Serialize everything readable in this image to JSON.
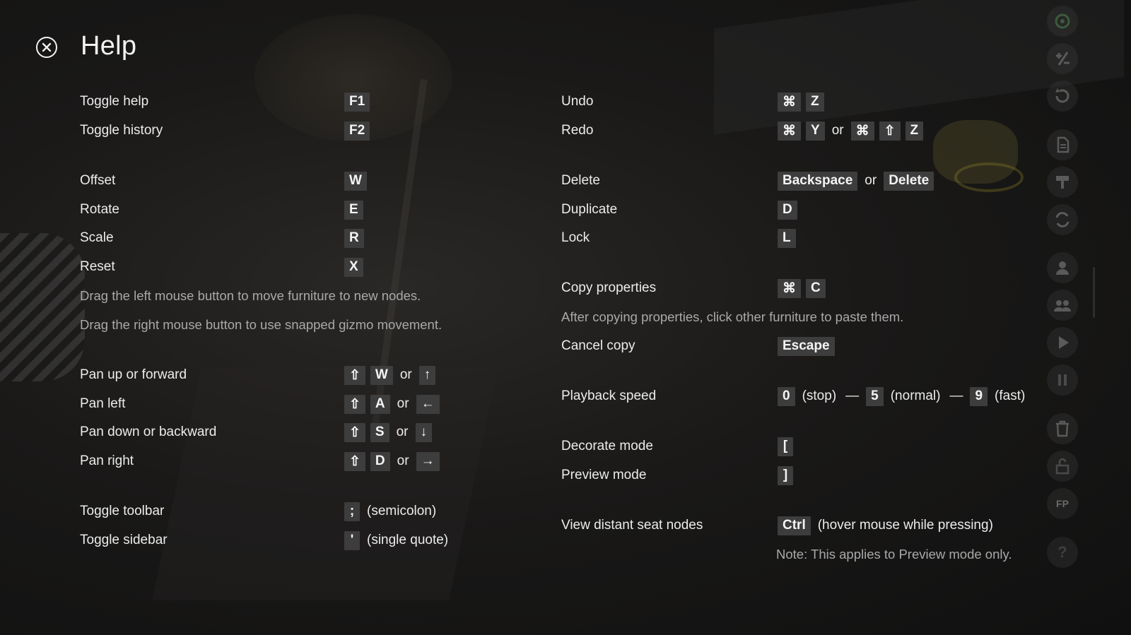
{
  "title": "Help",
  "left": {
    "toggle_help": {
      "label": "Toggle help",
      "key": "F1"
    },
    "toggle_history": {
      "label": "Toggle history",
      "key": "F2"
    },
    "offset": {
      "label": "Offset",
      "key": "W"
    },
    "rotate": {
      "label": "Rotate",
      "key": "E"
    },
    "scale": {
      "label": "Scale",
      "key": "R"
    },
    "reset": {
      "label": "Reset",
      "key": "X"
    },
    "note_drag_left": "Drag the left mouse button to move furniture to new nodes.",
    "note_drag_right": "Drag the right mouse button to use snapped gizmo movement.",
    "pan_up": {
      "label": "Pan up or forward",
      "mod": "⇧",
      "key": "W",
      "or": "or",
      "alt": "↑"
    },
    "pan_left": {
      "label": "Pan left",
      "mod": "⇧",
      "key": "A",
      "or": "or",
      "alt": "←"
    },
    "pan_down": {
      "label": "Pan down or backward",
      "mod": "⇧",
      "key": "S",
      "or": "or",
      "alt": "↓"
    },
    "pan_right": {
      "label": "Pan right",
      "mod": "⇧",
      "key": "D",
      "or": "or",
      "alt": "→"
    },
    "toggle_toolbar": {
      "label": "Toggle toolbar",
      "key": ";",
      "desc": "(semicolon)"
    },
    "toggle_sidebar": {
      "label": "Toggle sidebar",
      "key": "'",
      "desc": "(single quote)"
    }
  },
  "right": {
    "undo": {
      "label": "Undo",
      "k1": "⌘",
      "k2": "Z"
    },
    "redo": {
      "label": "Redo",
      "k1": "⌘",
      "k2": "Y",
      "or": "or",
      "k3": "⌘",
      "k4": "⇧",
      "k5": "Z"
    },
    "delete": {
      "label": "Delete",
      "k1": "Backspace",
      "or": "or",
      "k2": "Delete"
    },
    "duplicate": {
      "label": "Duplicate",
      "key": "D"
    },
    "lock": {
      "label": "Lock",
      "key": "L"
    },
    "copy_properties": {
      "label": "Copy properties",
      "k1": "⌘",
      "k2": "C"
    },
    "note_copy": "After copying properties, click other furniture to paste them.",
    "cancel_copy": {
      "label": "Cancel copy",
      "key": "Escape"
    },
    "playback_speed": {
      "label": "Playback speed",
      "k0": "0",
      "t0": "(stop)",
      "dash1": "—",
      "k5": "5",
      "t5": "(normal)",
      "dash2": "—",
      "k9": "9",
      "t9": "(fast)"
    },
    "decorate_mode": {
      "label": "Decorate mode",
      "key": "["
    },
    "preview_mode": {
      "label": "Preview mode",
      "key": "]"
    },
    "view_seat_nodes": {
      "label": "View distant seat nodes",
      "key": "Ctrl",
      "desc": "(hover mouse while pressing)"
    },
    "note_preview": "Note: This applies to Preview mode only."
  },
  "toolbar": {
    "icons": [
      "target-icon",
      "plus-minus-icon",
      "rotate-icon",
      "document-icon",
      "paint-roller-icon",
      "swap-icon",
      "person-icon",
      "group-icon",
      "play-icon",
      "pause-icon",
      "trash-icon",
      "unlock-icon",
      "first-person-icon",
      "question-icon"
    ],
    "fp_label": "FP",
    "question_label": "?"
  }
}
